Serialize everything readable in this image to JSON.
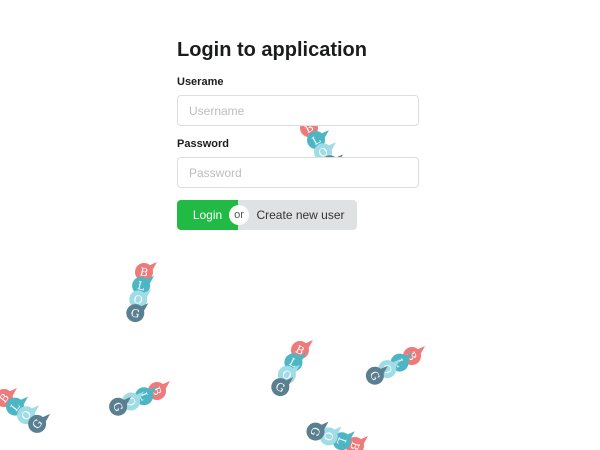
{
  "login": {
    "title": "Login to application",
    "username_label": "Userame",
    "username_placeholder": "Username",
    "password_label": "Password",
    "password_placeholder": "Password",
    "login_button": "Login",
    "divider": "or",
    "create_button": "Create new user"
  },
  "decoration": {
    "icon": "blog-bubble-icon",
    "letters": [
      "B",
      "L",
      "O",
      "G"
    ],
    "colors": [
      "#f07a7a",
      "#4db6c4",
      "#9fdce6",
      "#5a7f91"
    ]
  },
  "colors": {
    "login_green": "#21ba45",
    "secondary_grey": "#e0e1e2"
  }
}
